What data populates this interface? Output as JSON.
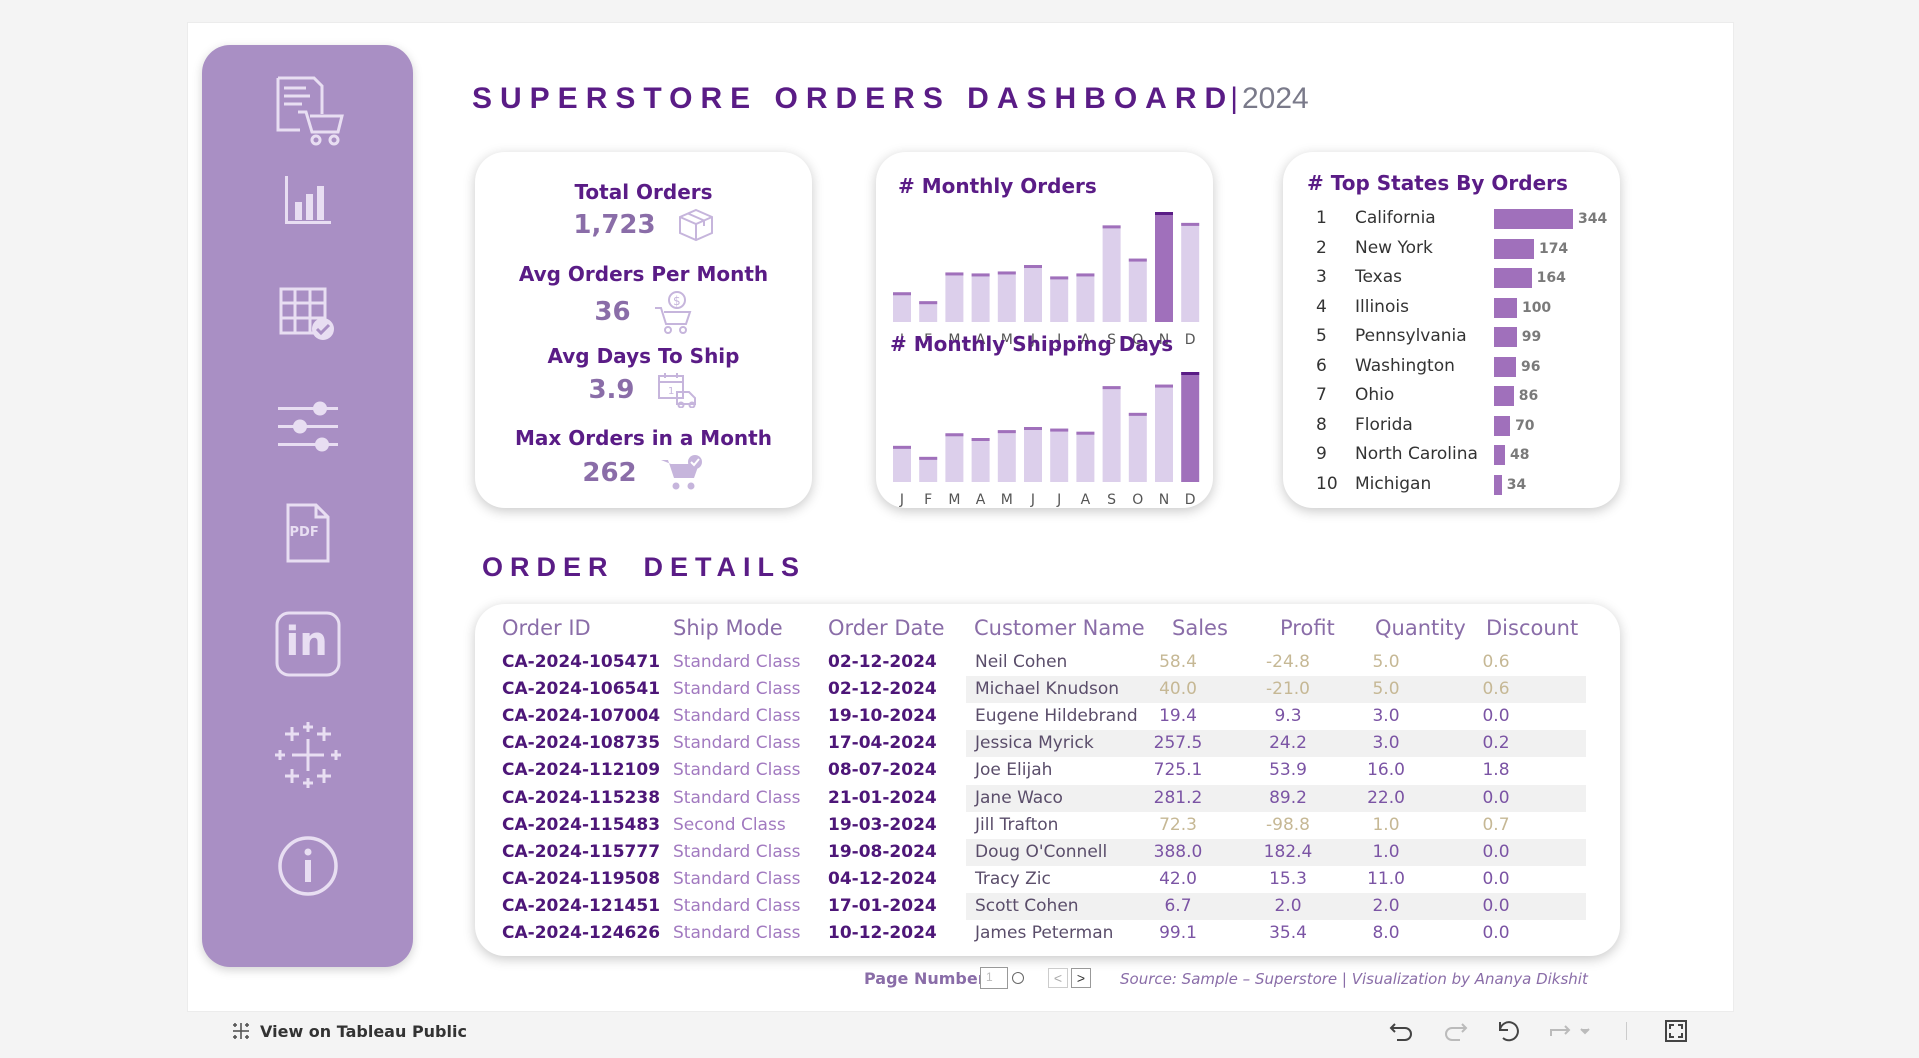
{
  "header": {
    "title": "SUPERSTORE ORDERS DASHBOARD",
    "separator": "|",
    "year": "2024"
  },
  "sidebar": {
    "items": [
      {
        "icon": "cart-receipt-icon"
      },
      {
        "icon": "bar-chart-icon"
      },
      {
        "icon": "table-check-icon"
      },
      {
        "icon": "sliders-icon"
      },
      {
        "icon": "pdf-icon",
        "text": "PDF"
      },
      {
        "icon": "linkedin-icon",
        "text": "in"
      },
      {
        "icon": "tableau-icon"
      },
      {
        "icon": "info-icon"
      }
    ]
  },
  "kpis": [
    {
      "label": "Total Orders",
      "value": "1,723",
      "icon": "box-icon"
    },
    {
      "label": "Avg Orders Per Month",
      "value": "36",
      "icon": "cart-dollar-icon"
    },
    {
      "label": "Avg Days To Ship",
      "value": "3.9",
      "icon": "calendar-truck-icon"
    },
    {
      "label": "Max Orders in a Month",
      "value": "262",
      "icon": "cart-check-icon"
    }
  ],
  "chart_data": [
    {
      "type": "bar",
      "title": "# Monthly Orders",
      "categories": [
        "J",
        "F",
        "M",
        "A",
        "M",
        "J",
        "J",
        "A",
        "S",
        "O",
        "N",
        "D"
      ],
      "values": [
        60,
        42,
        100,
        98,
        102,
        115,
        92,
        98,
        195,
        128,
        222,
        200
      ],
      "highlight_index": 10,
      "colors": {
        "bar": "#dccfeb",
        "highlight": "#a070bb",
        "highlight_cap": "#5a1c86"
      }
    },
    {
      "type": "bar",
      "title": "# Monthly Shipping Days",
      "categories": [
        "J",
        "F",
        "M",
        "A",
        "M",
        "J",
        "J",
        "A",
        "S",
        "O",
        "N",
        "D"
      ],
      "values": [
        230,
        160,
        310,
        280,
        330,
        350,
        340,
        320,
        610,
        440,
        620,
        700
      ],
      "highlight_index": 11,
      "colors": {
        "bar": "#dccfeb",
        "highlight": "#a070bb",
        "highlight_cap": "#5a1c86"
      }
    },
    {
      "type": "bar",
      "title": "# Top States By Orders",
      "categories": [
        "California",
        "New York",
        "Texas",
        "Illinois",
        "Pennsylvania",
        "Washington",
        "Ohio",
        "Florida",
        "North Carolina",
        "Michigan"
      ],
      "ranks": [
        "1",
        "2",
        "3",
        "4",
        "5",
        "6",
        "7",
        "8",
        "9",
        "10"
      ],
      "values": [
        344,
        174,
        164,
        100,
        99,
        96,
        86,
        70,
        48,
        34
      ]
    }
  ],
  "order_details": {
    "title": "ORDER  DETAILS",
    "columns": [
      "Order ID",
      "Ship Mode",
      "Order Date",
      "Customer Name",
      "Sales",
      "Profit",
      "Quantity",
      "Discount"
    ],
    "rows": [
      {
        "id": "CA-2024-105471",
        "mode": "Standard Class",
        "date": "02-12-2024",
        "customer": "Neil Cohen",
        "sales": "58.4",
        "profit": "-24.8",
        "qty": "5.0",
        "disc": "0.6",
        "negative": true
      },
      {
        "id": "CA-2024-106541",
        "mode": "Standard Class",
        "date": "02-12-2024",
        "customer": "Michael Knudson",
        "sales": "40.0",
        "profit": "-21.0",
        "qty": "5.0",
        "disc": "0.6",
        "negative": true
      },
      {
        "id": "CA-2024-107004",
        "mode": "Standard Class",
        "date": "19-10-2024",
        "customer": "Eugene Hildebrand",
        "sales": "19.4",
        "profit": "9.3",
        "qty": "3.0",
        "disc": "0.0",
        "negative": false
      },
      {
        "id": "CA-2024-108735",
        "mode": "Standard Class",
        "date": "17-04-2024",
        "customer": "Jessica Myrick",
        "sales": "257.5",
        "profit": "24.2",
        "qty": "3.0",
        "disc": "0.2",
        "negative": false
      },
      {
        "id": "CA-2024-112109",
        "mode": "Standard Class",
        "date": "08-07-2024",
        "customer": "Joe Elijah",
        "sales": "725.1",
        "profit": "53.9",
        "qty": "16.0",
        "disc": "1.8",
        "negative": false
      },
      {
        "id": "CA-2024-115238",
        "mode": "Standard Class",
        "date": "21-01-2024",
        "customer": "Jane Waco",
        "sales": "281.2",
        "profit": "89.2",
        "qty": "22.0",
        "disc": "0.0",
        "negative": false
      },
      {
        "id": "CA-2024-115483",
        "mode": "Second Class",
        "date": "19-03-2024",
        "customer": "Jill Trafton",
        "sales": "72.3",
        "profit": "-98.8",
        "qty": "1.0",
        "disc": "0.7",
        "negative": true
      },
      {
        "id": "CA-2024-115777",
        "mode": "Standard Class",
        "date": "19-08-2024",
        "customer": "Doug O'Connell",
        "sales": "388.0",
        "profit": "182.4",
        "qty": "1.0",
        "disc": "0.0",
        "negative": false
      },
      {
        "id": "CA-2024-119508",
        "mode": "Standard Class",
        "date": "04-12-2024",
        "customer": "Tracy Zic",
        "sales": "42.0",
        "profit": "15.3",
        "qty": "11.0",
        "disc": "0.0",
        "negative": false
      },
      {
        "id": "CA-2024-121451",
        "mode": "Standard Class",
        "date": "17-01-2024",
        "customer": "Scott Cohen",
        "sales": "6.7",
        "profit": "2.0",
        "qty": "2.0",
        "disc": "0.0",
        "negative": false
      },
      {
        "id": "CA-2024-124626",
        "mode": "Standard Class",
        "date": "10-12-2024",
        "customer": "James Peterman",
        "sales": "99.1",
        "profit": "35.4",
        "qty": "8.0",
        "disc": "0.0",
        "negative": false
      }
    ]
  },
  "pagination": {
    "label": "Page Number",
    "value": "1",
    "prev": "<",
    "next": ">"
  },
  "footer": {
    "source": "Source: Sample – Superstore | Visualization by Ananya Dikshit"
  },
  "toolbar": {
    "view_on_tableau": "View on Tableau Public"
  }
}
